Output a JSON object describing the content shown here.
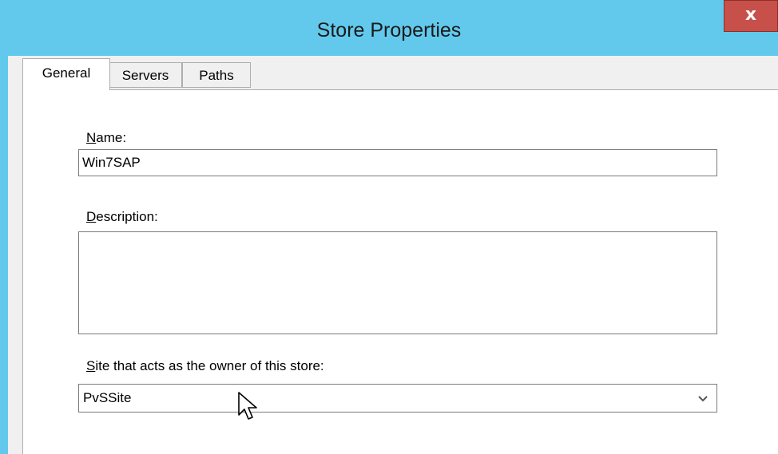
{
  "window": {
    "title": "Store Properties",
    "close_glyph": "x",
    "accent_color": "#62c9ec",
    "close_color": "#c7504a"
  },
  "tabs": [
    {
      "label": "General",
      "selected": true
    },
    {
      "label": "Servers",
      "selected": false
    },
    {
      "label": "Paths",
      "selected": false
    }
  ],
  "general": {
    "name_label": {
      "mnemonic": "N",
      "rest": "ame:"
    },
    "name_value": "Win7SAP",
    "description_label": {
      "mnemonic": "D",
      "rest": "escription:"
    },
    "description_value": "",
    "site_label": {
      "mnemonic": "S",
      "rest": "ite that acts as the owner of this store:"
    },
    "site_value": "PvSSite"
  },
  "icons": {
    "close": "close-icon",
    "dropdown": "chevron-down-icon",
    "cursor": "mouse-pointer-icon"
  }
}
